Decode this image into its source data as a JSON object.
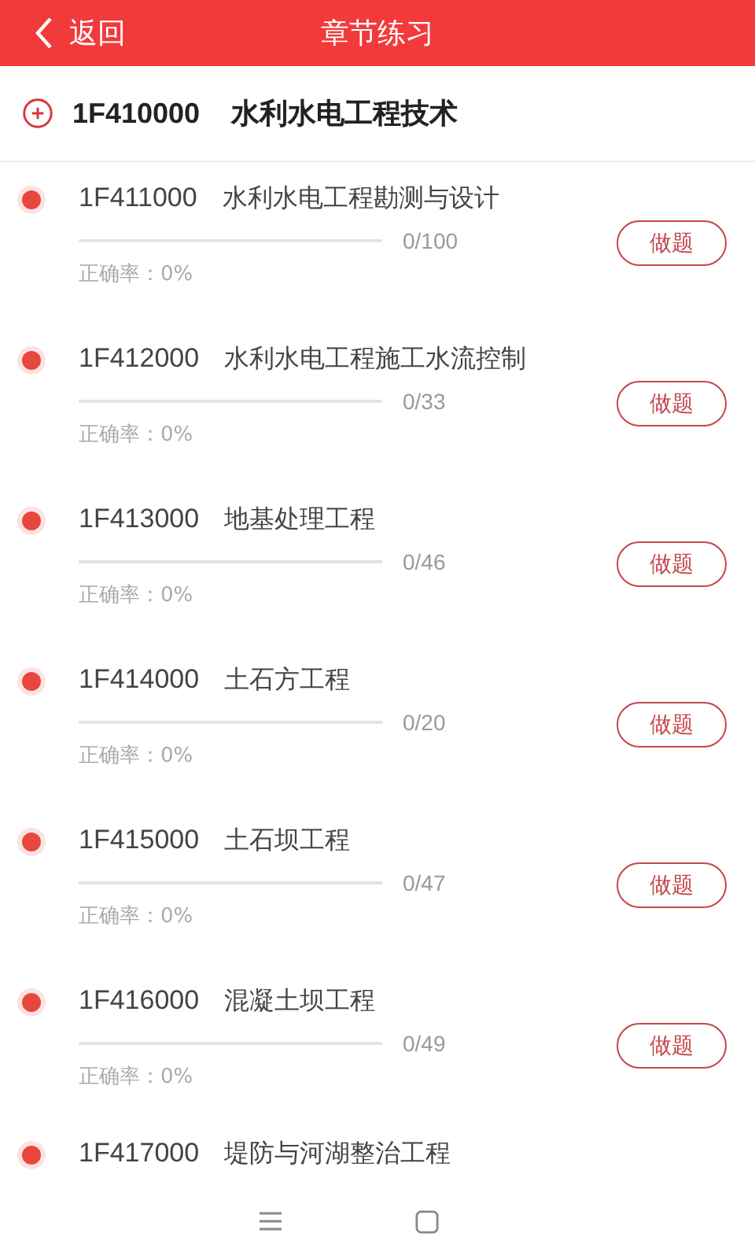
{
  "header": {
    "back_label": "返回",
    "title": "章节练习"
  },
  "section": {
    "code": "1F410000",
    "name": "水利水电工程技术"
  },
  "chapters": [
    {
      "code": "1F411000",
      "name": "水利水电工程勘测与设计",
      "count": "0/100",
      "accuracy": "正确率：0%",
      "button": "做题"
    },
    {
      "code": "1F412000",
      "name": "水利水电工程施工水流控制",
      "count": "0/33",
      "accuracy": "正确率：0%",
      "button": "做题"
    },
    {
      "code": "1F413000",
      "name": "地基处理工程",
      "count": "0/46",
      "accuracy": "正确率：0%",
      "button": "做题"
    },
    {
      "code": "1F414000",
      "name": "土石方工程",
      "count": "0/20",
      "accuracy": "正确率：0%",
      "button": "做题"
    },
    {
      "code": "1F415000",
      "name": "土石坝工程",
      "count": "0/47",
      "accuracy": "正确率：0%",
      "button": "做题"
    },
    {
      "code": "1F416000",
      "name": "混凝土坝工程",
      "count": "0/49",
      "accuracy": "正确率：0%",
      "button": "做题"
    },
    {
      "code": "1F417000",
      "name": "堤防与河湖整治工程"
    }
  ]
}
